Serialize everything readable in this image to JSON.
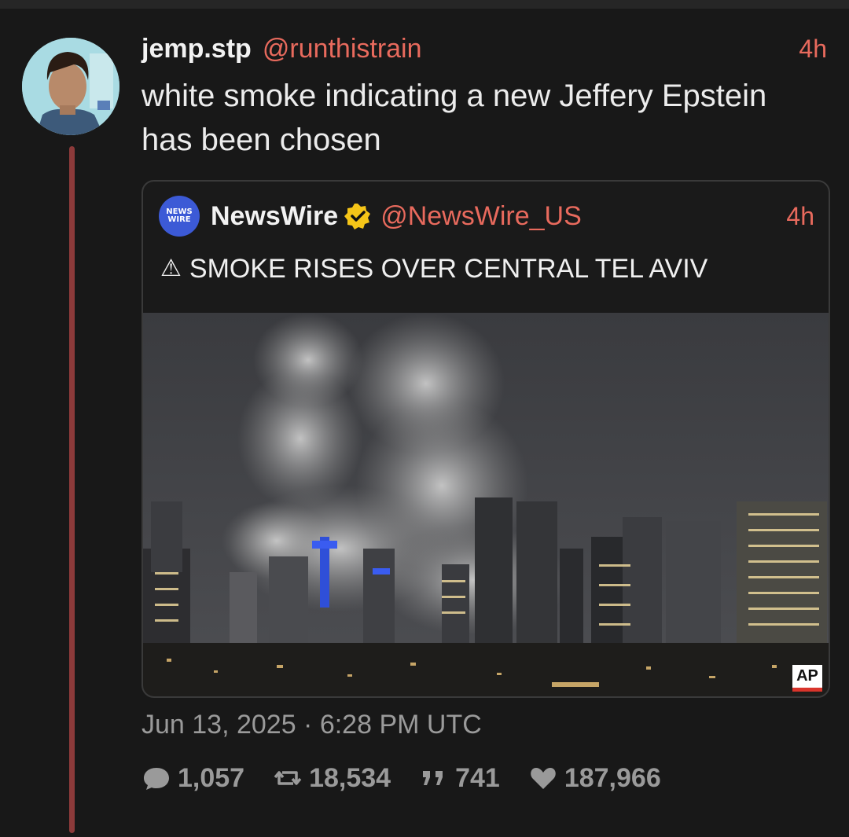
{
  "post": {
    "author_name": "jemp.stp",
    "author_handle": "@runthistrain",
    "time": "4h",
    "text": "white smoke indicating a new Jeffery Epstein\nhas been chosen",
    "timestamp": "Jun 13, 2025 · 6:28 PM UTC",
    "stats": {
      "replies": "1,057",
      "reposts": "18,534",
      "quotes": "741",
      "likes": "187,966"
    }
  },
  "quote": {
    "logo_text": "NEWS WIRE",
    "author_name": "NewsWire",
    "author_handle": "@NewsWire_US",
    "time": "4h",
    "warning_icon": "⚠",
    "text": "SMOKE RISES OVER CENTRAL TEL AVIV",
    "image_credit": "AP"
  },
  "colors": {
    "accent": "#e86a5d",
    "thread_line": "#8c3a3a",
    "verified": "#f5c518",
    "muted": "#9a9a9a"
  },
  "icons": [
    "reply-icon",
    "repost-icon",
    "quote-icon",
    "like-icon",
    "verified-icon",
    "warning-icon"
  ]
}
